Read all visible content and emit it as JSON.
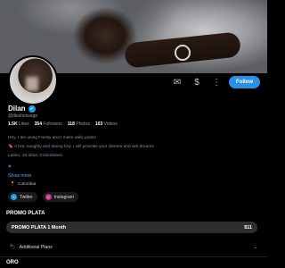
{
  "profile": {
    "name": "Dilan",
    "handle": "@dieshessage",
    "stats": [
      {
        "value": "1.5K",
        "label": "Likes"
      },
      {
        "value": "354",
        "label": "Followers"
      },
      {
        "value": "118",
        "label": "Photos"
      },
      {
        "value": "103",
        "label": "Videos"
      }
    ],
    "bio_lines": [
      "Hey, I am using Fansly and I make daily posts!",
      "🔖 A hot, naughty and daring boy, I will provoke your desires and wet dreams",
      "Latino, 19 años, Colombiano"
    ],
    "show_more": "Show more",
    "location": "Colombia"
  },
  "actions": {
    "message_icon": "message-icon",
    "tip_icon": "dollar-icon",
    "follow_label": "Follow"
  },
  "socials": [
    {
      "label": "Twitter",
      "icon": "twitter-x-icon",
      "color": "#1d9bf0"
    },
    {
      "label": "Instagram",
      "icon": "instagram-icon",
      "color": "#c13584"
    }
  ],
  "subscriptions": {
    "section1_title": "PROMO PLATA",
    "plan_label": "PROMO PLATA 1 Month",
    "plan_price": "$11",
    "additional_plans": "Additional Plans",
    "section2_title": "ORO"
  },
  "colors": {
    "accent": "#2b8fe6",
    "link": "#6aa8ff",
    "verified": "#1d9bf0"
  }
}
